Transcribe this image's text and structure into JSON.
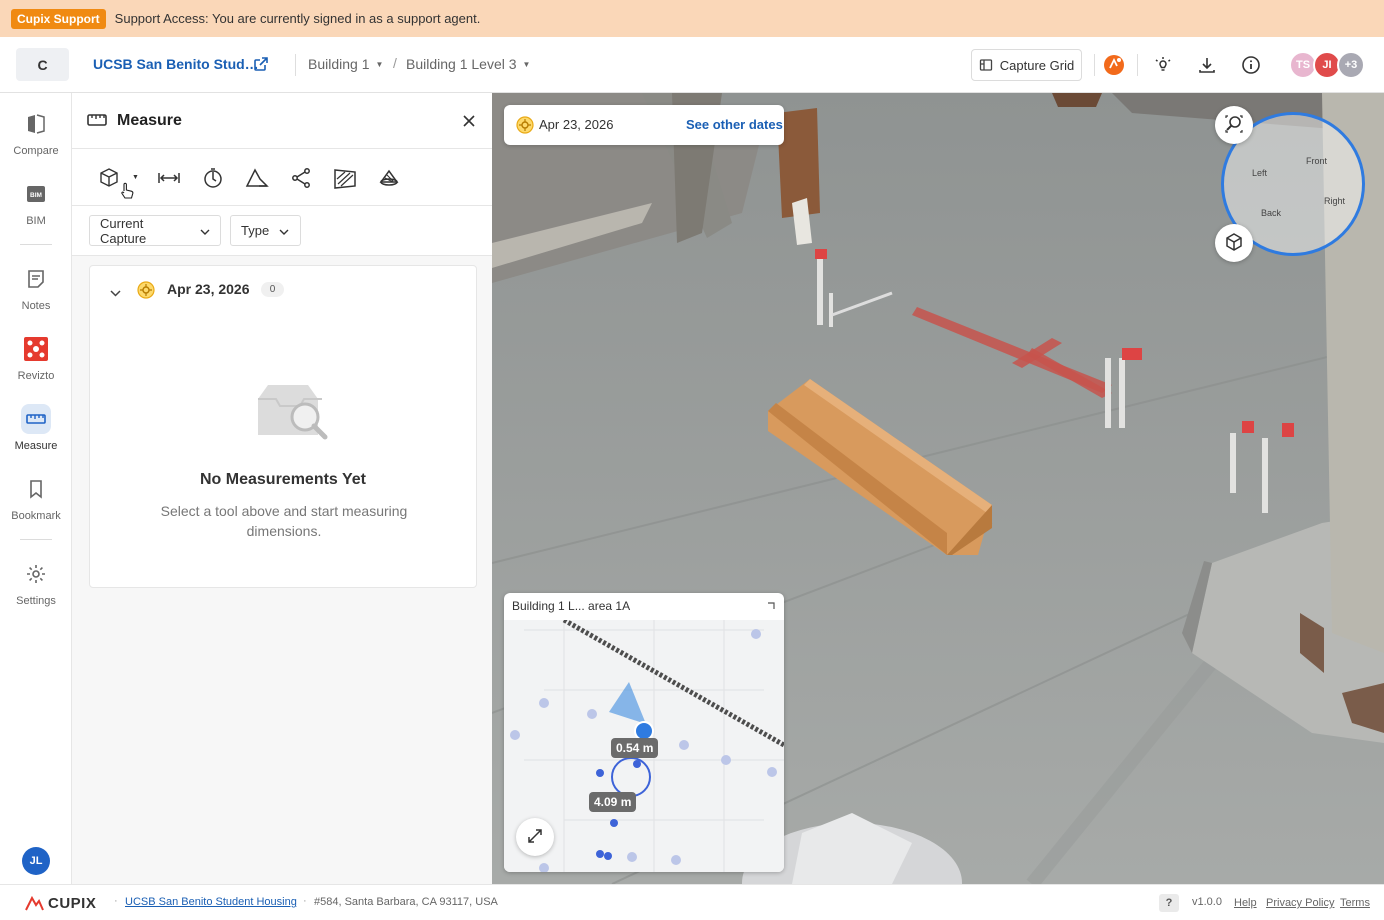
{
  "banner": {
    "badge": "Cupix Support",
    "message": "Support Access: You are currently signed in as a support agent."
  },
  "header": {
    "logo_letter": "C",
    "project": "UCSB San Benito Stud…",
    "building": "Building 1",
    "level": "Building 1 Level 3",
    "capture_grid": "Capture Grid",
    "avatars": [
      {
        "initials": "TS",
        "color": "#e8b6cf"
      },
      {
        "initials": "JI",
        "color": "#e04b4b"
      },
      {
        "initials": "+3",
        "color": "#a9a9b3"
      }
    ]
  },
  "sidebar": {
    "items": [
      {
        "label": "Compare",
        "icon": "compare-icon"
      },
      {
        "label": "BIM",
        "icon": "bim-icon"
      },
      {
        "label": "Notes",
        "icon": "notes-icon"
      },
      {
        "label": "Revizto",
        "icon": "revizto-icon"
      },
      {
        "label": "Measure",
        "icon": "measure-icon",
        "active": true
      },
      {
        "label": "Bookmark",
        "icon": "bookmark-icon"
      },
      {
        "label": "Settings",
        "icon": "gear-icon"
      }
    ],
    "user_initials": "JL"
  },
  "panel": {
    "title": "Measure",
    "filters": {
      "capture": "Current Capture",
      "type": "Type"
    },
    "group": {
      "date": "Apr 23, 2026",
      "count": "0"
    },
    "empty": {
      "title": "No Measurements Yet",
      "subtitle": "Select a tool above and start measuring dimensions."
    }
  },
  "view": {
    "date": "Apr 23, 2026",
    "see_other": "See other dates",
    "compass": {
      "front": "Front",
      "left": "Left",
      "right": "Right",
      "back": "Back"
    },
    "minimap": {
      "title": "Building 1 L... area 1A",
      "tag1": "0.54 m",
      "tag2": "4.09 m"
    }
  },
  "footer": {
    "brand": "CUPIX",
    "project": "UCSB San Benito Student Housing",
    "address": "#584, Santa Barbara, CA 93117, USA",
    "help_q": "?",
    "version": "v1.0.0",
    "help": "Help",
    "privacy": "Privacy Policy",
    "terms": "Terms"
  },
  "colors": {
    "accent": "#1a5fb4",
    "banner": "#fad7b8",
    "badge": "#f08a12",
    "active_bg": "#dde8f6"
  }
}
